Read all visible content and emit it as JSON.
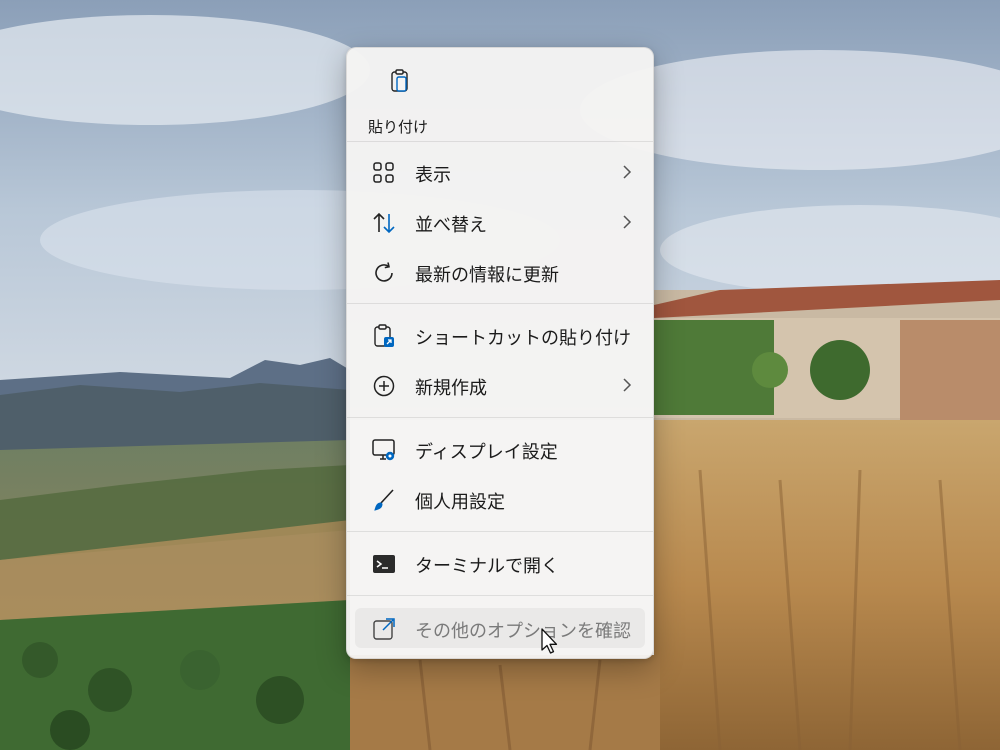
{
  "desktop": {
    "wallpaper": "landscape-photo: cliff-top hotel, green valley, mountains, cloudy sky"
  },
  "context_menu": {
    "paste": {
      "label": "貼り付け",
      "icon": "clipboard-icon"
    },
    "items": [
      {
        "label": "表示",
        "icon": "grid-icon",
        "submenu": true
      },
      {
        "label": "並べ替え",
        "icon": "sort-arrows-icon",
        "submenu": true
      },
      {
        "label": "最新の情報に更新",
        "icon": "refresh-icon",
        "submenu": false
      },
      {
        "label": "ショートカットの貼り付け",
        "icon": "paste-shortcut-icon",
        "submenu": false
      },
      {
        "label": "新規作成",
        "icon": "plus-circle-icon",
        "submenu": true
      },
      {
        "label": "ディスプレイ設定",
        "icon": "display-settings-icon",
        "submenu": false
      },
      {
        "label": "個人用設定",
        "icon": "brush-icon",
        "submenu": false
      },
      {
        "label": "ターミナルで開く",
        "icon": "terminal-icon",
        "submenu": false
      },
      {
        "label": "その他のオプションを確認",
        "icon": "external-options-icon",
        "submenu": false,
        "hovered": true
      }
    ]
  },
  "colors": {
    "menu_bg": "#f5f4f3",
    "text": "#1b1b1b",
    "accent_blue": "#0067c0",
    "hover_text": "#7a7a7a"
  }
}
